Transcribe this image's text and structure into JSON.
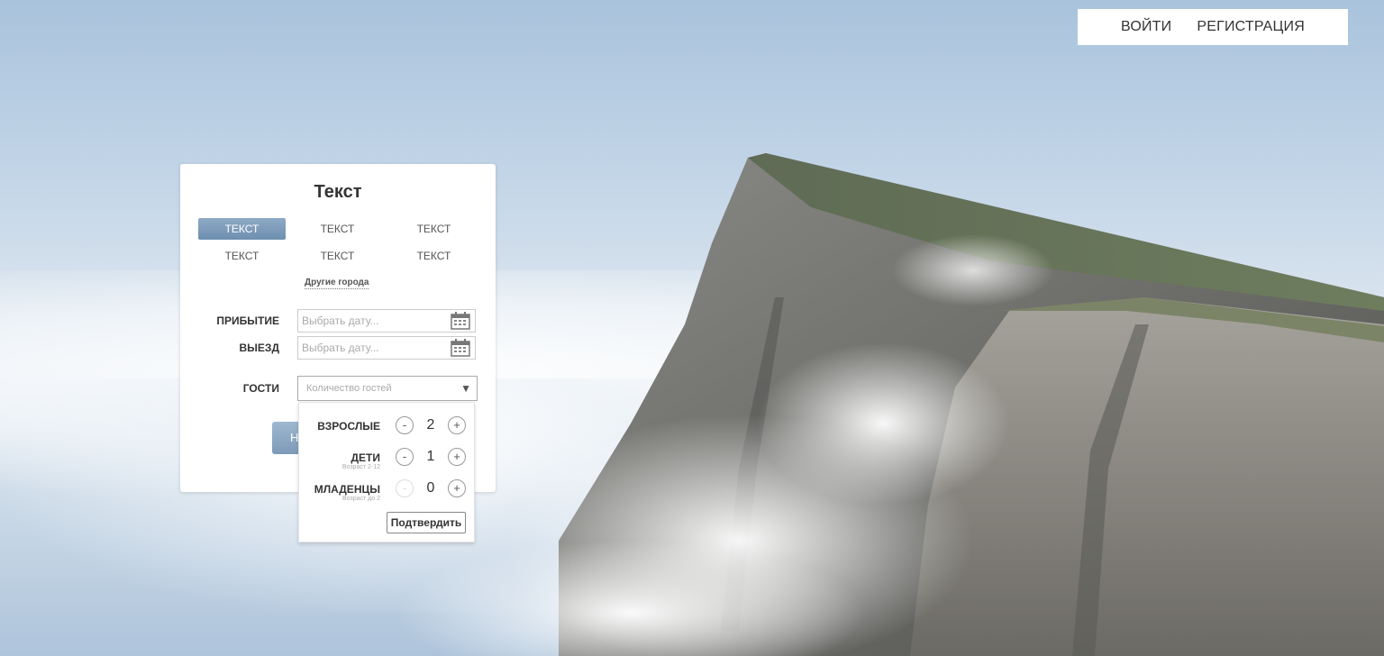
{
  "nav": {
    "login": "ВОЙТИ",
    "register": "РЕГИСТРАЦИЯ"
  },
  "card": {
    "title": "Текст",
    "cities": [
      "ТЕКСТ",
      "ТЕКСТ",
      "ТЕКСТ",
      "ТЕКСТ",
      "ТЕКСТ",
      "ТЕКСТ"
    ],
    "other_cities": "Другие города",
    "arrival_label": "ПРИБЫТИЕ",
    "departure_label": "ВЫЕЗД",
    "date_placeholder": "Выбрать дату...",
    "guests_label": "ГОСТИ",
    "guests_placeholder": "Количество гостей",
    "search_button": "Н"
  },
  "guests": {
    "adults_label": "ВЗРОСЛЫЕ",
    "adults_count": "2",
    "children_label": "ДЕТИ",
    "children_sub": "Возраст 2-12",
    "children_count": "1",
    "infants_label": "МЛАДЕНЦЫ",
    "infants_sub": "Возраст до 2",
    "infants_count": "0",
    "minus": "-",
    "plus": "+",
    "confirm": "Подтвердить"
  }
}
